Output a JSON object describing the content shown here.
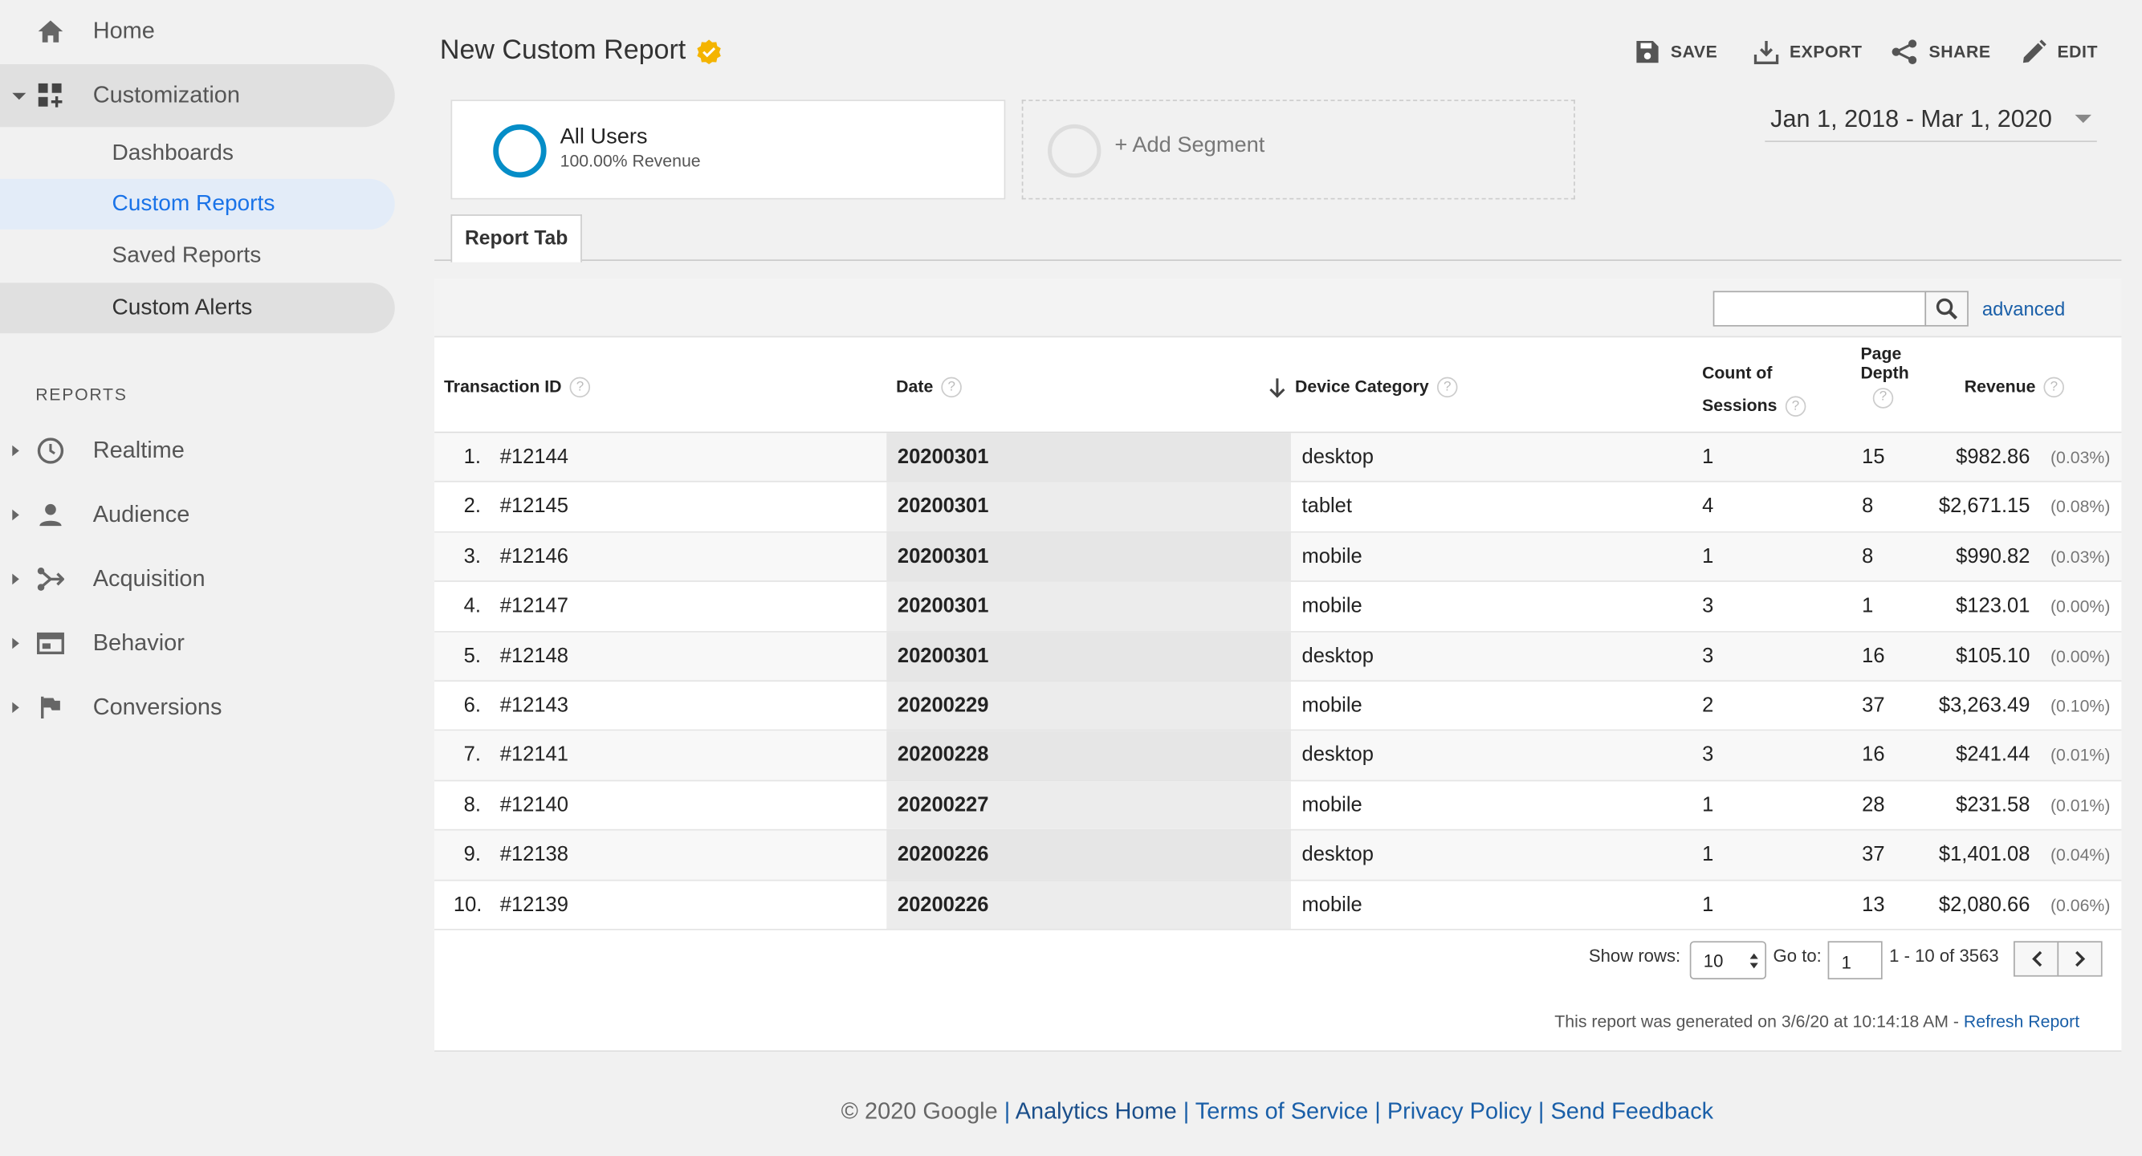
{
  "sidebar": {
    "home": "Home",
    "customization": "Customization",
    "sub_items": [
      "Dashboards",
      "Custom Reports",
      "Saved Reports",
      "Custom Alerts"
    ],
    "reports_heading": "REPORTS",
    "reports": [
      "Realtime",
      "Audience",
      "Acquisition",
      "Behavior",
      "Conversions"
    ]
  },
  "header": {
    "title": "New Custom Report",
    "save": "SAVE",
    "export": "EXPORT",
    "share": "SHARE",
    "edit": "EDIT"
  },
  "segments": {
    "all_users": "All Users",
    "all_users_sub": "100.00% Revenue",
    "add_segment": "+ Add Segment"
  },
  "date_range": "Jan 1, 2018 - Mar 1, 2020",
  "report_tab": "Report Tab",
  "toolbar": {
    "search_placeholder": "",
    "advanced": "advanced"
  },
  "table": {
    "columns": {
      "transaction_id": "Transaction ID",
      "date": "Date",
      "device_category": "Device Category",
      "count_of": "Count of",
      "sessions": "Sessions",
      "page": "Page",
      "depth": "Depth",
      "revenue": "Revenue"
    },
    "rows": [
      {
        "n": "1.",
        "id": "#12144",
        "date": "20200301",
        "device": "desktop",
        "sessions": "1",
        "depth": "15",
        "revenue": "$982.86",
        "pct": "(0.03%)"
      },
      {
        "n": "2.",
        "id": "#12145",
        "date": "20200301",
        "device": "tablet",
        "sessions": "4",
        "depth": "8",
        "revenue": "$2,671.15",
        "pct": "(0.08%)"
      },
      {
        "n": "3.",
        "id": "#12146",
        "date": "20200301",
        "device": "mobile",
        "sessions": "1",
        "depth": "8",
        "revenue": "$990.82",
        "pct": "(0.03%)"
      },
      {
        "n": "4.",
        "id": "#12147",
        "date": "20200301",
        "device": "mobile",
        "sessions": "3",
        "depth": "1",
        "revenue": "$123.01",
        "pct": "(0.00%)"
      },
      {
        "n": "5.",
        "id": "#12148",
        "date": "20200301",
        "device": "desktop",
        "sessions": "3",
        "depth": "16",
        "revenue": "$105.10",
        "pct": "(0.00%)"
      },
      {
        "n": "6.",
        "id": "#12143",
        "date": "20200229",
        "device": "mobile",
        "sessions": "2",
        "depth": "37",
        "revenue": "$3,263.49",
        "pct": "(0.10%)"
      },
      {
        "n": "7.",
        "id": "#12141",
        "date": "20200228",
        "device": "desktop",
        "sessions": "3",
        "depth": "16",
        "revenue": "$241.44",
        "pct": "(0.01%)"
      },
      {
        "n": "8.",
        "id": "#12140",
        "date": "20200227",
        "device": "mobile",
        "sessions": "1",
        "depth": "28",
        "revenue": "$231.58",
        "pct": "(0.01%)"
      },
      {
        "n": "9.",
        "id": "#12138",
        "date": "20200226",
        "device": "desktop",
        "sessions": "1",
        "depth": "37",
        "revenue": "$1,401.08",
        "pct": "(0.04%)"
      },
      {
        "n": "10.",
        "id": "#12139",
        "date": "20200226",
        "device": "mobile",
        "sessions": "1",
        "depth": "13",
        "revenue": "$2,080.66",
        "pct": "(0.06%)"
      }
    ]
  },
  "pagination": {
    "show_rows_label": "Show rows:",
    "show_rows_value": "10",
    "goto_label": "Go to:",
    "goto_value": "1",
    "range": "1 - 10 of 3563"
  },
  "generated": {
    "text": "This report was generated on 3/6/20 at 10:14:18 AM - ",
    "refresh": "Refresh Report"
  },
  "footer": {
    "copyright": "© 2020 Google",
    "analytics_home": "Analytics Home",
    "terms": "Terms of Service",
    "privacy": "Privacy Policy",
    "feedback": "Send Feedback",
    "separator": "|"
  },
  "colors": {
    "accent_blue": "#1a73e8",
    "link_blue": "#1a5fa8",
    "segment_blue": "#058dc7",
    "verified_yellow": "#f4b400"
  }
}
